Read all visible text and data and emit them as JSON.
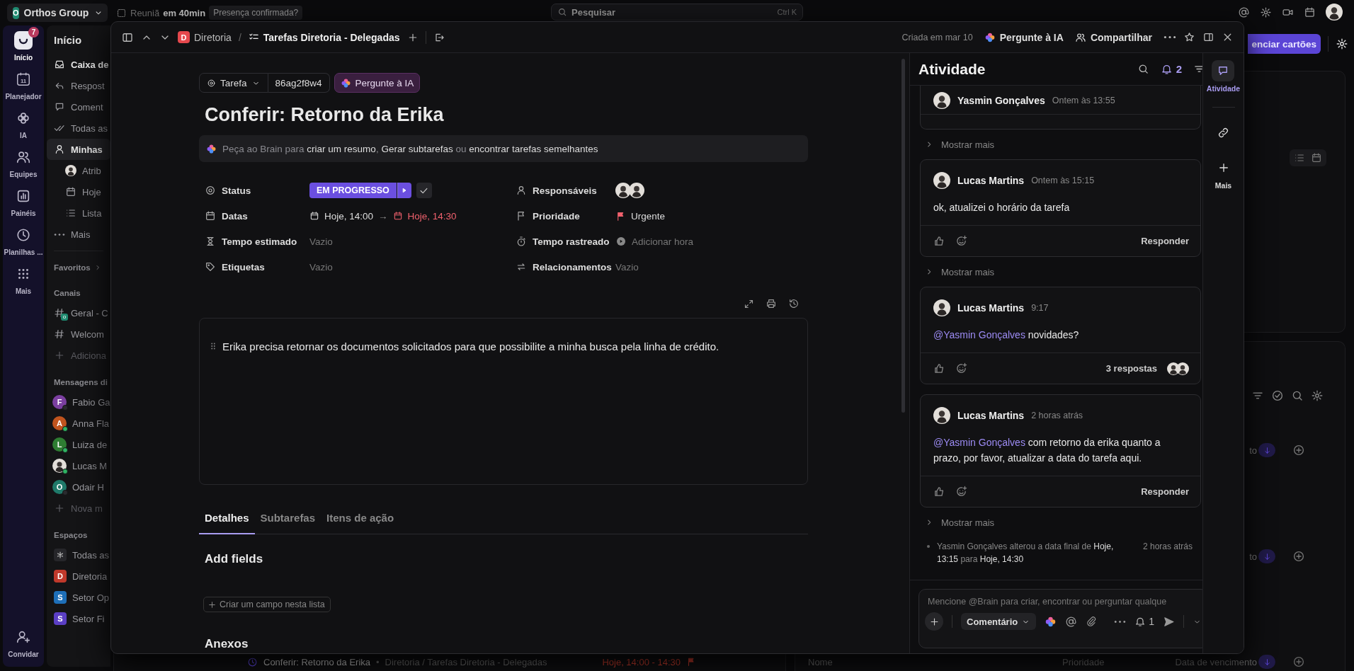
{
  "top_bar": {
    "workspace_initial": "O",
    "workspace": "Orthos Group",
    "meeting": "Reuniã",
    "meeting_time": "em 40min",
    "meeting_status": "Presença confirmada?",
    "search": {
      "placeholder": "Pesquisar",
      "shortcut": "Ctrl K"
    }
  },
  "rail": {
    "items": [
      {
        "kind": "home",
        "label": "Início",
        "badge": "7",
        "selected": true
      },
      {
        "kind": "planner",
        "label": "Planejador",
        "icon_text": "11",
        "selected": false
      },
      {
        "kind": "ai",
        "label": "IA",
        "selected": false
      },
      {
        "kind": "teams",
        "label": "Equipes",
        "selected": false
      },
      {
        "kind": "dashboards",
        "label": "Painéis",
        "selected": false
      },
      {
        "kind": "timesheets",
        "label": "Planilhas ...",
        "selected": false
      },
      {
        "kind": "more",
        "label": "Mais",
        "selected": false
      }
    ],
    "invite": "Convidar"
  },
  "sidebar": {
    "title": "Início",
    "items": [
      {
        "kind": "inbox",
        "label": "Caixa de",
        "unread": true,
        "selected": false
      },
      {
        "kind": "replies",
        "label": "Respost",
        "unread": false,
        "selected": false
      },
      {
        "kind": "comments",
        "label": "Coment",
        "unread": false,
        "selected": false
      },
      {
        "kind": "all",
        "label": "Todas as",
        "unread": false,
        "selected": false
      },
      {
        "kind": "my",
        "label": "Minhas",
        "unread": false,
        "selected": true,
        "children": [
          {
            "kind": "avatar",
            "label": "Atrib",
            "unread": false,
            "selected": false
          },
          {
            "kind": "today",
            "label": "Hoje",
            "unread": false,
            "selected": false
          },
          {
            "kind": "list",
            "label": "Lista",
            "unread": false,
            "selected": false
          }
        ]
      },
      {
        "kind": "more",
        "label": "Mais",
        "unread": false,
        "selected": false
      }
    ],
    "favorites": "Favoritos",
    "channels_title": "Canais",
    "channels": [
      {
        "kind": "general",
        "label": "Geral - C",
        "badge": "o"
      },
      {
        "kind": "channel",
        "label": "Welcom"
      },
      {
        "kind": "add",
        "label": "Adiciona"
      }
    ],
    "dm_title": "Mensagens di",
    "dms": [
      {
        "kind": "letter",
        "initial": "F",
        "label": "Fabio Ga",
        "color": "#7b3fa0",
        "online": false
      },
      {
        "kind": "letter",
        "initial": "A",
        "label": "Anna Fla",
        "color": "#c0541e",
        "online": true
      },
      {
        "kind": "letter",
        "initial": "L",
        "label": "Luiza de",
        "color": "#2e7d32",
        "online": true
      },
      {
        "kind": "photo",
        "label": "Lucas M",
        "online": true
      },
      {
        "kind": "letter",
        "initial": "O",
        "label": "Odair H",
        "color": "#1f7a6a",
        "online": false
      },
      {
        "kind": "add",
        "label": "Nova m"
      }
    ],
    "spaces_title": "Espaços",
    "spaces": [
      {
        "kind": "all",
        "label": "Todas as"
      },
      {
        "kind": "letter",
        "initial": "D",
        "label": "Diretoria",
        "color": "#c0392b"
      },
      {
        "kind": "letter",
        "initial": "S",
        "label": "Setor Op",
        "color": "#1e6fb8"
      },
      {
        "kind": "letter",
        "initial": "S",
        "label": "Setor Fi",
        "color": "#5b3fc4"
      }
    ]
  },
  "background": {
    "manage_button": "enciar cartões",
    "list_row": {
      "title": "Conferir: Retorno da Erika",
      "bullet": "•",
      "path": "Diretoria / Tarefas Diretoria - Delegadas",
      "dates": "Hoje, 14:00 - 14:30"
    },
    "column_fragments": [
      "to",
      "to"
    ],
    "columns": [
      "Nome",
      "Prioridade",
      "Data de vencimento"
    ]
  },
  "modal": {
    "breadcrumb": {
      "space_initial": "D",
      "space": "Diretoria",
      "separator": "/",
      "list": "Tarefas Diretoria - Delegadas"
    },
    "created": "Criada em mar 10",
    "ask_ai": "Pergunte à IA",
    "share": "Compartilhar"
  },
  "task": {
    "type": "Tarefa",
    "id": "86ag2f8w4",
    "ask_ai": "Pergunte à IA",
    "title": "Conferir: Retorno da Erika",
    "brain_bar": [
      {
        "kind": "text",
        "text": "Peça ao Brain para"
      },
      {
        "kind": "link",
        "text": "criar um resumo"
      },
      {
        "kind": "punct",
        "text": ","
      },
      {
        "kind": "link",
        "text": "Gerar subtarefas"
      },
      {
        "kind": "text",
        "text": "ou"
      },
      {
        "kind": "link",
        "text": "encontrar tarefas semelhantes"
      }
    ],
    "fields": [
      {
        "kind": "status",
        "label": "Status",
        "value": "EM PROGRESSO"
      },
      {
        "kind": "assignees",
        "label": "Responsáveis",
        "avatars": [
          {
            "kind": "photo"
          },
          {
            "kind": "photo"
          }
        ]
      },
      {
        "kind": "dates",
        "label": "Datas",
        "start": "Hoje, 14:00",
        "arrow": "→",
        "end": "Hoje, 14:30",
        "end_overdue": true
      },
      {
        "kind": "priority",
        "label": "Prioridade",
        "value": "Urgente"
      },
      {
        "kind": "estimate",
        "label": "Tempo estimado",
        "value": "Vazio"
      },
      {
        "kind": "tracked",
        "label": "Tempo rastreado",
        "value": "Adicionar hora"
      },
      {
        "kind": "tags",
        "label": "Etiquetas",
        "value": "Vazio"
      },
      {
        "kind": "relations",
        "label": "Relacionamentos",
        "value": "Vazio"
      }
    ],
    "description": "Erika precisa retornar os documentos solicitados para que possibilite a minha busca pela linha de crédito.",
    "tabs": [
      {
        "label": "Detalhes",
        "selected": true
      },
      {
        "label": "Subtarefas",
        "selected": false
      },
      {
        "label": "Itens de ação",
        "selected": false
      }
    ],
    "add_fields_title": "Add fields",
    "create_field_button": "Criar um campo nesta lista",
    "attachments_title": "Anexos"
  },
  "activity": {
    "title": "Atividade",
    "bell_count": "2",
    "items": [
      {
        "kind": "comment_clipped",
        "author": "Yasmin Gonçalves",
        "time": "Ontem às 13:55"
      },
      {
        "kind": "show_more",
        "label": "Mostrar mais"
      },
      {
        "kind": "comment",
        "author": "Lucas Martins",
        "time": "Ontem às 15:15",
        "body": "ok, atualizei o horário da tarefa",
        "reply": "Responder"
      },
      {
        "kind": "show_more",
        "label": "Mostrar mais"
      },
      {
        "kind": "comment",
        "author": "Lucas Martins",
        "time": "9:17",
        "mention": "@Yasmin Gonçalves",
        "body": "novidades?",
        "replies": "3 respostas"
      },
      {
        "kind": "comment",
        "author": "Lucas Martins",
        "time": "2 horas atrás",
        "mention": "@Yasmin Gonçalves",
        "body": "com retorno da erika quanto a prazo, por favor, atualizar a data do tarefa aqui.",
        "reply": "Responder"
      },
      {
        "kind": "show_more",
        "label": "Mostrar mais"
      },
      {
        "kind": "log",
        "parts": [
          {
            "kind": "text",
            "text": "Yasmin Gonçalves alterou a data final de"
          },
          {
            "kind": "value",
            "text": "Hoje, 13:15"
          },
          {
            "kind": "text",
            "text": "para"
          },
          {
            "kind": "value",
            "text": "Hoje, 14:30"
          }
        ],
        "time": "2 horas atrás"
      }
    ],
    "composer": {
      "placeholder": "Mencione @Brain para criar, encontrar ou perguntar qualque",
      "type": "Comentário",
      "notify_count": "1"
    }
  },
  "side_rail": {
    "items": [
      {
        "kind": "activity",
        "label": "Atividade",
        "selected": true
      },
      {
        "kind": "links",
        "selected": false
      },
      {
        "kind": "more",
        "label": "Mais",
        "selected": false
      }
    ]
  }
}
